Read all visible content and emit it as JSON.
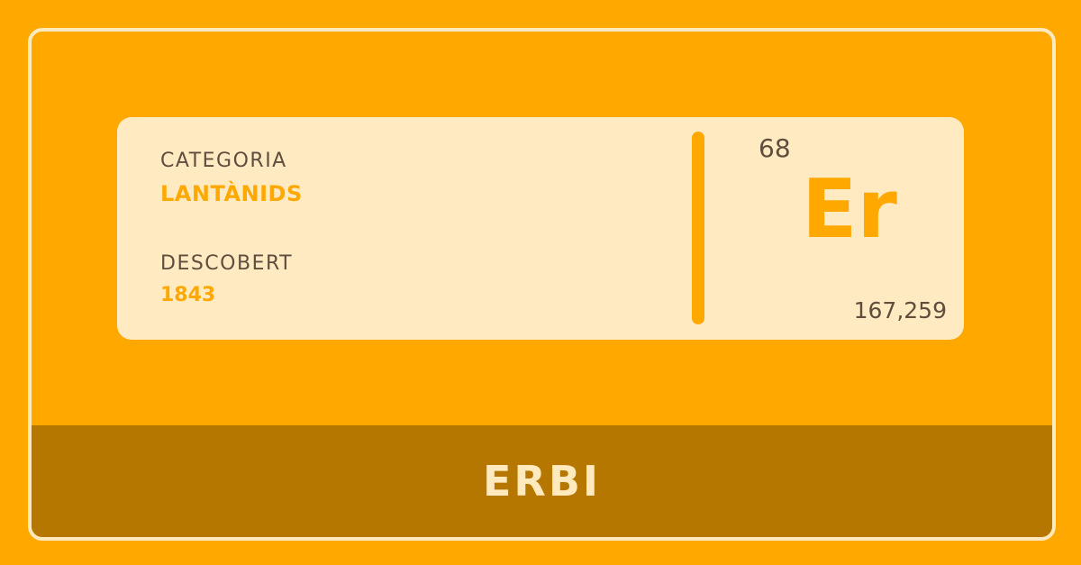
{
  "card": {
    "category_label": "CATEGORIA",
    "category_value": "LANTÀNIDS",
    "discovered_label": "DESCOBERT",
    "discovered_value": "1843"
  },
  "element": {
    "atomic_number": "68",
    "symbol": "Er",
    "atomic_mass": "167,259",
    "name": "ERBI"
  },
  "colors": {
    "background": "#ffa800",
    "card": "#ffeac2",
    "accent": "#ffa800",
    "name_bar": "#b67700",
    "text_dark": "#5f4e3e",
    "text_light": "#ffe9bd"
  }
}
